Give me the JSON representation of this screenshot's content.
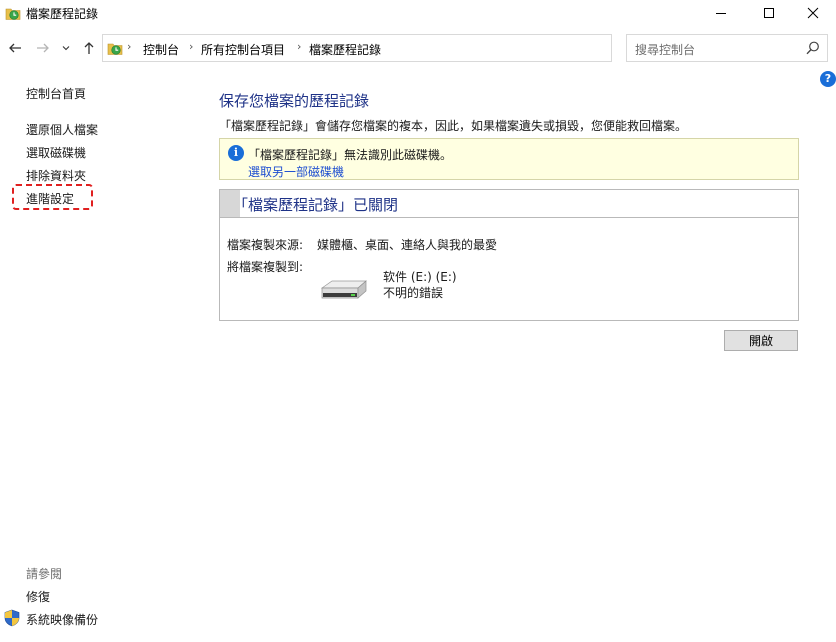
{
  "window": {
    "title": "檔案歷程記錄",
    "icon": "file-history-icon"
  },
  "nav": {
    "breadcrumbs": [
      "控制台",
      "所有控制台項目",
      "檔案歷程記錄"
    ],
    "search_placeholder": "搜尋控制台"
  },
  "sidebar": {
    "home": "控制台首頁",
    "items": [
      "還原個人檔案",
      "選取磁碟機",
      "排除資料夾",
      "進階設定"
    ],
    "see_also_label": "請參閱",
    "see_also": [
      "修復",
      "系統映像備份"
    ],
    "highlight_color": "#e02020"
  },
  "main": {
    "title": "保存您檔案的歷程記錄",
    "description": "「檔案歷程記錄」會儲存您檔案的複本，因此，如果檔案遺失或損毀，您便能救回檔案。",
    "info": {
      "message": "「檔案歷程記錄」無法識別此磁碟機。",
      "link": "選取另一部磁碟機"
    },
    "status": {
      "title": "「檔案歷程記錄」已關閉",
      "source_label": "檔案複製來源:",
      "source_value": "媒體櫃、桌面、連絡人與我的最愛",
      "dest_label": "將檔案複製到:",
      "drive_name": "软件 (E:) (E:)",
      "drive_status": "不明的錯誤"
    },
    "open_button": "開啟"
  },
  "colors": {
    "accent_title": "#1e3287",
    "link": "#1f4fd1",
    "info_bg": "#ffffe1"
  }
}
